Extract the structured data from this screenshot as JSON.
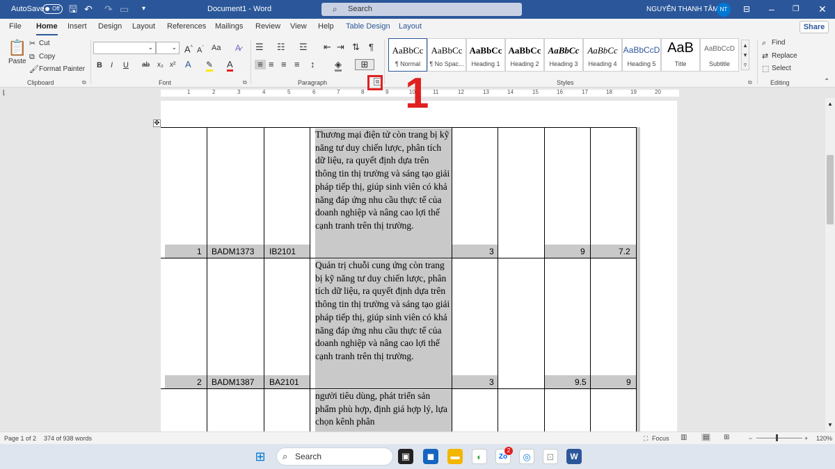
{
  "titlebar": {
    "autosave_label": "AutoSave",
    "autosave_state": "Off",
    "doc_title": "Document1  -  Word",
    "search_placeholder": "Search",
    "user_name": "NGUYỄN THANH TÂM",
    "user_initials": "NT"
  },
  "tabs": [
    "File",
    "Home",
    "Insert",
    "Design",
    "Layout",
    "References",
    "Mailings",
    "Review",
    "View",
    "Help",
    "Table Design",
    "Layout"
  ],
  "active_tab": "Home",
  "share_label": "Share",
  "clipboard": {
    "paste": "Paste",
    "cut": "Cut",
    "copy": "Copy",
    "format_painter": "Format Painter",
    "group": "Clipboard"
  },
  "font": {
    "format_buttons": [
      "B",
      "I",
      "U",
      "ab",
      "x₂",
      "x²"
    ],
    "case_label": "Aa",
    "group": "Font"
  },
  "paragraph": {
    "pilcrow": "¶",
    "group": "Paragraph"
  },
  "styles": {
    "items": [
      {
        "preview": "AaBbCc",
        "name": "¶ Normal"
      },
      {
        "preview": "AaBbCc",
        "name": "¶ No Spac..."
      },
      {
        "preview": "AaBbCc",
        "name": "Heading 1"
      },
      {
        "preview": "AaBbCc",
        "name": "Heading 2"
      },
      {
        "preview": "AaBbCc",
        "name": "Heading 3"
      },
      {
        "preview": "AaBbCc",
        "name": "Heading 4"
      },
      {
        "preview": "AaBbCcD",
        "name": "Heading 5"
      },
      {
        "preview": "AaB",
        "name": "Title"
      },
      {
        "preview": "AaBbCcD",
        "name": "Subtitle"
      }
    ],
    "group": "Styles"
  },
  "editing": {
    "find": "Find",
    "replace": "Replace",
    "select": "Select",
    "group": "Editing"
  },
  "ruler": {
    "numbers": [
      "1",
      "2",
      "3",
      "4",
      "5",
      "6",
      "7",
      "8",
      "9",
      "10",
      "11",
      "12",
      "13",
      "14",
      "15",
      "16",
      "17",
      "18",
      "19",
      "20"
    ]
  },
  "table": {
    "rows": [
      {
        "no": "1",
        "code": "BADM1373",
        "cls": "IB2101",
        "desc": "Thương mại điện tử còn trang bị kỹ năng tư duy chiến lược, phân tích dữ liệu, ra quyết định dựa trên thông tin thị trường và sáng tạo giải pháp tiếp thị, giúp sinh viên có khả năng đáp ứng nhu cầu thực tế của doanh nghiệp và nâng cao lợi thế cạnh tranh trên thị trường.",
        "c5": "3",
        "c6": "",
        "c7": "9",
        "c8": "7.2"
      },
      {
        "no": "2",
        "code": "BADM1387",
        "cls": "BA2101",
        "desc": "Quản trị chuỗi cung ứng còn trang bị kỹ năng tư duy chiến lược, phân tích dữ liệu, ra quyết định dựa trên thông tin thị trường và sáng tạo giải pháp tiếp thị, giúp sinh viên có khả năng đáp ứng nhu cầu thực tế của doanh nghiệp và nâng cao lợi thế cạnh tranh trên thị trường.",
        "c5": "3",
        "c6": "",
        "c7": "9.5",
        "c8": "9"
      },
      {
        "no": "",
        "code": "",
        "cls": "",
        "desc": "người tiêu dùng, phát triển sản phẩm phù hợp, định giá hợp lý, lựa chọn kênh phân",
        "c5": "",
        "c6": "",
        "c7": "",
        "c8": ""
      }
    ]
  },
  "status": {
    "page": "Page 1 of 2",
    "words": "374 of 938 words",
    "focus": "Focus",
    "zoom": "120%",
    "zoom_minus": "−",
    "zoom_plus": "+"
  },
  "taskbar": {
    "search_placeholder": "Search",
    "badge": "2"
  },
  "annotation": {
    "number": "1"
  },
  "colors": {
    "word_blue": "#2b579a",
    "annotation_red": "#e02020",
    "cell_shade": "#c9c9c9"
  }
}
